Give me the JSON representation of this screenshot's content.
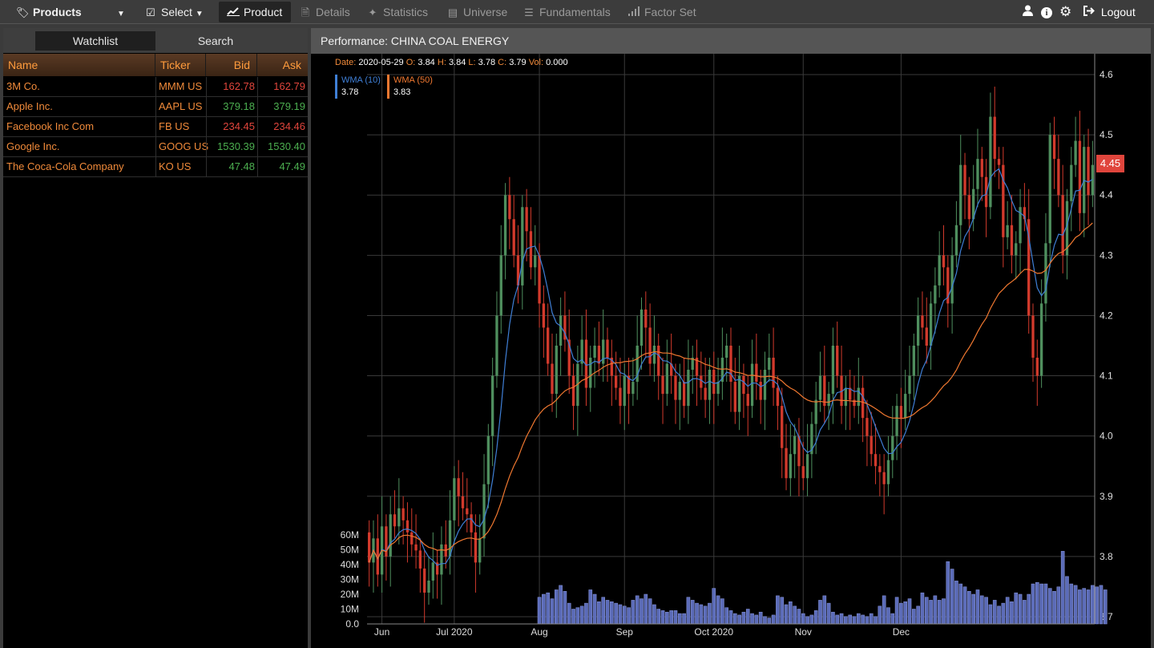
{
  "toolbar": {
    "products_label": "Products",
    "select_label": "Select",
    "product_label": "Product",
    "details_label": "Details",
    "statistics_label": "Statistics",
    "universe_label": "Universe",
    "fundamentals_label": "Fundamentals",
    "factor_set_label": "Factor Set",
    "logout_label": "Logout",
    "icons": [
      "tags-icon",
      "check-square-icon",
      "chart-line-icon",
      "file-icon",
      "magic-wand-icon",
      "table-icon",
      "list-icon",
      "bar-signal-icon",
      "user-icon",
      "info-icon",
      "gear-icon",
      "logout-icon"
    ]
  },
  "watchlist": {
    "tab_watchlist": "Watchlist",
    "tab_search": "Search",
    "columns": {
      "name": "Name",
      "ticker": "Ticker",
      "bid": "Bid",
      "ask": "Ask"
    },
    "rows": [
      {
        "name": "3M Co.",
        "ticker": "MMM US",
        "bid": "162.78",
        "ask": "162.79",
        "bid_color": "#e0453c",
        "ask_color": "#e0453c"
      },
      {
        "name": "Apple Inc.",
        "ticker": "AAPL US",
        "bid": "379.18",
        "ask": "379.19",
        "bid_color": "#4caf50",
        "ask_color": "#4caf50"
      },
      {
        "name": "Facebook Inc Com",
        "ticker": "FB US",
        "bid": "234.45",
        "ask": "234.46",
        "bid_color": "#e0453c",
        "ask_color": "#e0453c"
      },
      {
        "name": "Google Inc.",
        "ticker": "GOOG US",
        "bid": "1530.39",
        "ask": "1530.40",
        "bid_color": "#4caf50",
        "ask_color": "#4caf50"
      },
      {
        "name": "The Coca-Cola Company",
        "ticker": "KO US",
        "bid": "47.48",
        "ask": "47.49",
        "bid_color": "#4caf50",
        "ask_color": "#4caf50"
      }
    ]
  },
  "performance": {
    "title": "Performance: CHINA COAL ENERGY",
    "ohlc": {
      "date_label": "Date:",
      "date": "2020-05-29",
      "open_label": "O:",
      "open": "3.84",
      "high_label": "H:",
      "high": "3.84",
      "low_label": "L:",
      "low": "3.78",
      "close_label": "C:",
      "close": "3.79",
      "vol_label": "Vol:",
      "vol": "0.000"
    },
    "legend": [
      {
        "label": "WMA (10)",
        "value": "3.78",
        "color": "#3f7fd6"
      },
      {
        "label": "WMA (50)",
        "value": "3.83",
        "color": "#f07830"
      }
    ],
    "last_price": "4.45",
    "last_price_color": "#e0453c"
  },
  "chart_data": {
    "type": "candlestick",
    "y_ticks": [
      "4.6",
      "4.5",
      "4.4",
      "4.3",
      "4.2",
      "4.1",
      "4.0",
      "3.9",
      "3.8",
      "3.7"
    ],
    "ylim": [
      3.7,
      4.6
    ],
    "volume_ticks": [
      "60M",
      "50M",
      "40M",
      "30M",
      "20M",
      "10M",
      "0.0"
    ],
    "volume_lim": [
      0,
      60
    ],
    "x_ticks": [
      "Jun",
      "Jul 2020",
      "Aug",
      "Sep",
      "Oct 2020",
      "Nov",
      "Dec"
    ],
    "up_color": "#4f8f5e",
    "down_color": "#d23a2c",
    "volume_color": "#5b6bb8",
    "closes": [
      3.79,
      3.83,
      3.77,
      3.85,
      3.8,
      3.87,
      3.85,
      3.88,
      3.86,
      3.84,
      3.82,
      3.81,
      3.78,
      3.74,
      3.76,
      3.79,
      3.77,
      3.82,
      3.8,
      3.86,
      3.93,
      3.9,
      3.88,
      3.87,
      3.84,
      3.79,
      3.83,
      3.92,
      4.0,
      4.1,
      4.2,
      4.3,
      4.4,
      4.36,
      4.3,
      4.25,
      4.38,
      4.34,
      4.28,
      4.3,
      4.22,
      4.18,
      4.12,
      4.07,
      4.15,
      4.2,
      4.16,
      4.1,
      4.05,
      4.12,
      4.16,
      4.08,
      4.13,
      4.15,
      4.12,
      4.16,
      4.13,
      4.1,
      4.08,
      4.05,
      4.1,
      4.07,
      4.09,
      4.15,
      4.21,
      4.18,
      4.12,
      4.15,
      4.1,
      4.07,
      4.12,
      4.1,
      4.06,
      4.09,
      4.05,
      4.11,
      4.13,
      4.1,
      4.08,
      4.06,
      4.11,
      4.07,
      4.09,
      4.13,
      4.15,
      4.09,
      4.04,
      4.1,
      4.07,
      4.05,
      4.12,
      4.09,
      4.06,
      4.11,
      4.13,
      4.08,
      4.05,
      3.98,
      3.93,
      3.97,
      4.0,
      3.95,
      3.93,
      3.97,
      4.02,
      4.06,
      4.1,
      4.05,
      4.07,
      4.15,
      4.1,
      4.05,
      4.08,
      4.06,
      4.05,
      4.08,
      4.03,
      4.0,
      3.97,
      3.95,
      3.94,
      3.92,
      3.96,
      4.0,
      4.05,
      4.03,
      4.07,
      4.1,
      4.15,
      4.2,
      4.18,
      4.15,
      4.22,
      4.25,
      4.3,
      4.28,
      4.22,
      4.3,
      4.35,
      4.45,
      4.4,
      4.36,
      4.41,
      4.46,
      4.43,
      4.38,
      4.53,
      4.46,
      4.45,
      4.33,
      4.35,
      4.3,
      4.32,
      4.38,
      4.36,
      4.2,
      4.13,
      4.1,
      4.22,
      4.32,
      4.5,
      4.46,
      4.4,
      4.3,
      4.39,
      4.45,
      4.49,
      4.37,
      4.48,
      4.4,
      4.45
    ],
    "volumes": [
      0,
      0,
      0,
      0,
      0,
      0,
      0,
      0,
      0,
      0,
      0,
      0,
      0,
      0,
      0,
      0,
      0,
      0,
      0,
      0,
      0,
      0,
      0,
      0,
      0,
      0,
      0,
      0,
      0,
      0,
      0,
      0,
      0,
      0,
      0,
      0,
      0,
      0,
      0,
      0,
      18,
      20,
      21,
      17,
      23,
      26,
      22,
      14,
      10,
      11,
      12,
      14,
      23,
      20,
      15,
      18,
      16,
      15,
      14,
      13,
      12,
      11,
      16,
      19,
      17,
      20,
      17,
      13,
      10,
      9,
      8,
      9,
      9,
      7,
      7,
      18,
      16,
      14,
      13,
      12,
      14,
      24,
      19,
      17,
      11,
      9,
      7,
      6,
      8,
      10,
      7,
      6,
      8,
      5,
      4,
      6,
      19,
      18,
      13,
      15,
      12,
      10,
      7,
      5,
      6,
      9,
      16,
      19,
      14,
      8,
      6,
      7,
      5,
      6,
      5,
      7,
      6,
      5,
      7,
      5,
      12,
      19,
      11,
      7,
      18,
      14,
      15,
      17,
      10,
      12,
      21,
      18,
      16,
      19,
      16,
      17,
      42,
      37,
      29,
      27,
      25,
      22,
      20,
      23,
      19,
      18,
      13,
      16,
      12,
      14,
      18,
      15,
      21,
      20,
      16,
      20,
      27,
      28,
      27,
      27,
      24,
      22,
      25,
      49,
      32,
      27,
      26,
      23,
      24,
      23,
      26,
      25,
      26,
      23
    ]
  }
}
